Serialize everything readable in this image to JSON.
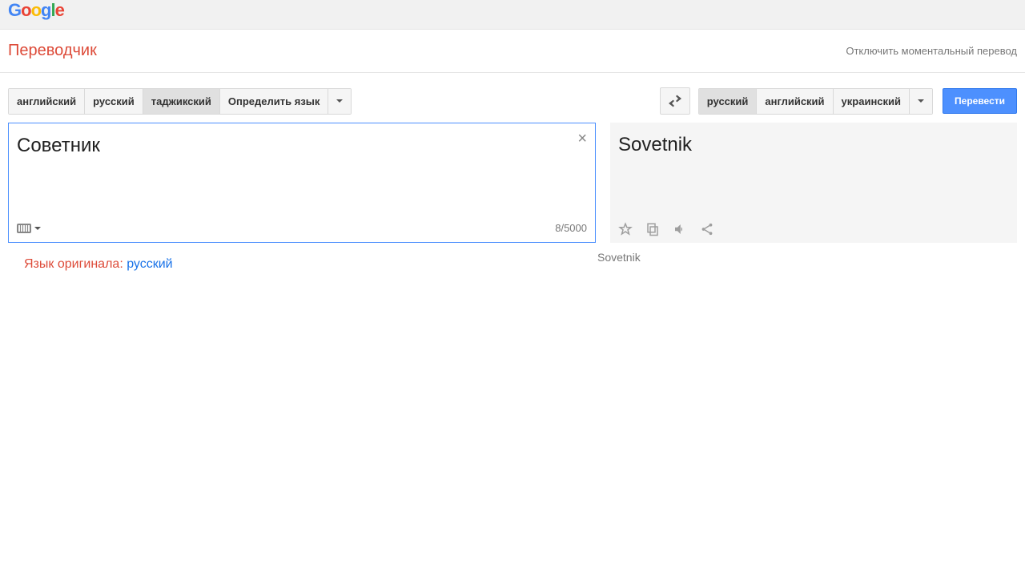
{
  "header": {
    "logo_letters": [
      "G",
      "o",
      "o",
      "g",
      "l",
      "e"
    ],
    "app_title": "Переводчик",
    "instant_link": "Отключить моментальный перевод"
  },
  "source_langs": {
    "items": [
      "английский",
      "русский",
      "таджикский",
      "Определить язык"
    ],
    "active_index": 2
  },
  "target_langs": {
    "items": [
      "русский",
      "английский",
      "украинский"
    ],
    "active_index": 0
  },
  "translate_button": "Перевести",
  "source": {
    "text": "Советник",
    "char_count": "8/5000"
  },
  "result": {
    "text": "Sovetnik",
    "translit": "Sovetnik"
  },
  "detected": {
    "label": "Язык оригинала: ",
    "lang": "русский"
  }
}
